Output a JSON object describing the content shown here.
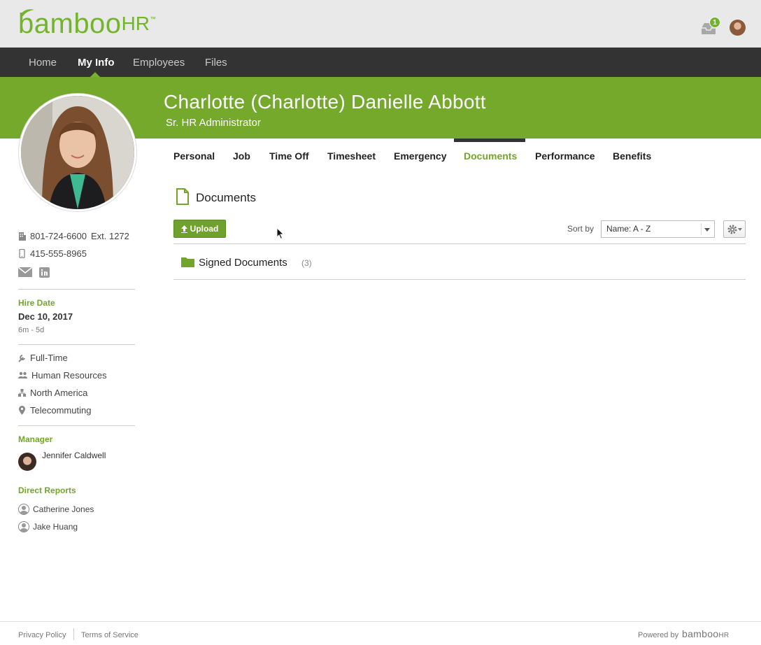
{
  "brand": {
    "name": "bamboo",
    "suffix": "HR",
    "tm": "™",
    "color": "#73b52a"
  },
  "header": {
    "notification_count": "1"
  },
  "nav": {
    "items": [
      {
        "label": "Home"
      },
      {
        "label": "My Info"
      },
      {
        "label": "Employees"
      },
      {
        "label": "Files"
      }
    ],
    "active": "My Info"
  },
  "employee": {
    "name": "Charlotte (Charlotte) Danielle Abbott",
    "title": "Sr. HR Administrator"
  },
  "tabs": [
    {
      "label": "Personal"
    },
    {
      "label": "Job"
    },
    {
      "label": "Time Off"
    },
    {
      "label": "Timesheet"
    },
    {
      "label": "Emergency"
    },
    {
      "label": "Documents"
    },
    {
      "label": "Performance"
    },
    {
      "label": "Benefits"
    }
  ],
  "active_tab": "Documents",
  "documents": {
    "heading": "Documents",
    "upload_label": "Upload",
    "sort_label": "Sort by",
    "sort_value": "Name: A - Z",
    "folders": [
      {
        "name": "Signed Documents",
        "count": "(3)"
      }
    ]
  },
  "sidebar": {
    "work_phone": "801-724-6600",
    "work_ext": "Ext. 1272",
    "mobile_phone": "415-555-8965",
    "hire_date_label": "Hire Date",
    "hire_date": "Dec 10, 2017",
    "tenure": "6m - 5d",
    "details": [
      {
        "icon": "wrench-icon",
        "label": "Full-Time"
      },
      {
        "icon": "people-icon",
        "label": "Human Resources"
      },
      {
        "icon": "org-chart-icon",
        "label": "North America"
      },
      {
        "icon": "location-pin-icon",
        "label": "Telecommuting"
      }
    ],
    "manager_label": "Manager",
    "manager_name": "Jennifer Caldwell",
    "direct_reports_label": "Direct Reports",
    "direct_reports": [
      {
        "name": "Catherine Jones"
      },
      {
        "name": "Jake Huang"
      }
    ]
  },
  "footer": {
    "privacy": "Privacy Policy",
    "terms": "Terms of Service",
    "powered_by": "Powered by",
    "powered_logo": "bamboo",
    "powered_logo_suffix": "HR"
  }
}
